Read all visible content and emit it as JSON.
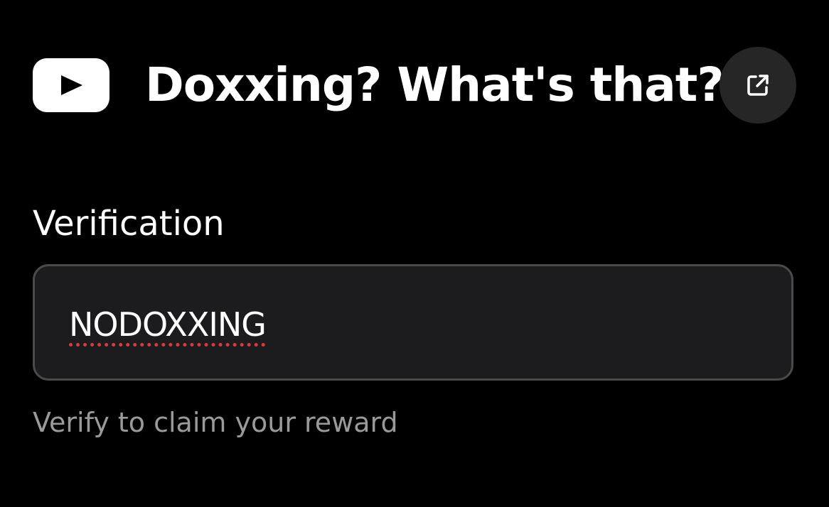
{
  "header": {
    "title": "Doxxing? What's that?",
    "logo_icon": "youtube-play-icon",
    "share_icon": "external-link-icon"
  },
  "verification": {
    "label": "Verification",
    "value": "NODOXXING",
    "helper": "Verify to claim your reward"
  },
  "colors": {
    "background": "#000000",
    "input_background": "#1c1c1e",
    "input_border": "#4a4a4a",
    "share_button": "#262626",
    "helper_text": "#9a9a9a",
    "spellcheck": "#d93b3b"
  }
}
